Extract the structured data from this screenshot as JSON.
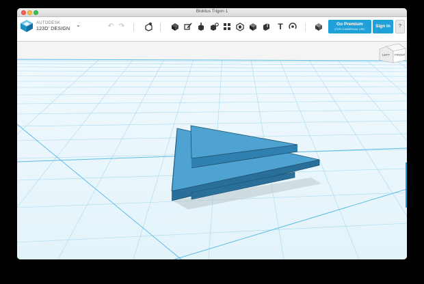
{
  "window": {
    "title": "Bloktus Trigon 1"
  },
  "app": {
    "brand_top": "AUTODESK",
    "brand_bottom": "123D' DESIGN",
    "menu_caret": "⌄"
  },
  "toolbar": {
    "undo_icon": "undo-icon",
    "redo_icon": "redo-icon",
    "transform_icon": "transform-icon",
    "primitives_icon": "primitives-icon",
    "sketch_icon": "sketch-icon",
    "construct_icon": "construct-icon",
    "modify_icon": "modify-icon",
    "pattern_icon": "pattern-icon",
    "grouping_icon": "grouping-icon",
    "combine_icon": "combine-icon",
    "measure_icon": "measure-icon",
    "text_label": "T",
    "snap_icon": "snap-icon",
    "material_icon": "material-icon",
    "premium_label": "Go Premium",
    "premium_sub": "(FOR COMMERCIAL USE)",
    "signin_label": "Sign In",
    "help_label": "?"
  },
  "viewcube": {
    "left_face": "LEFT",
    "front_face": "FRONT"
  },
  "colors": {
    "accent": "#1fa0d8",
    "grid_bg": "#e7f5fb",
    "grid_line": "#9fd6ee",
    "shape_top": "#4ea7d8",
    "shape_side": "#2f7fb0"
  }
}
